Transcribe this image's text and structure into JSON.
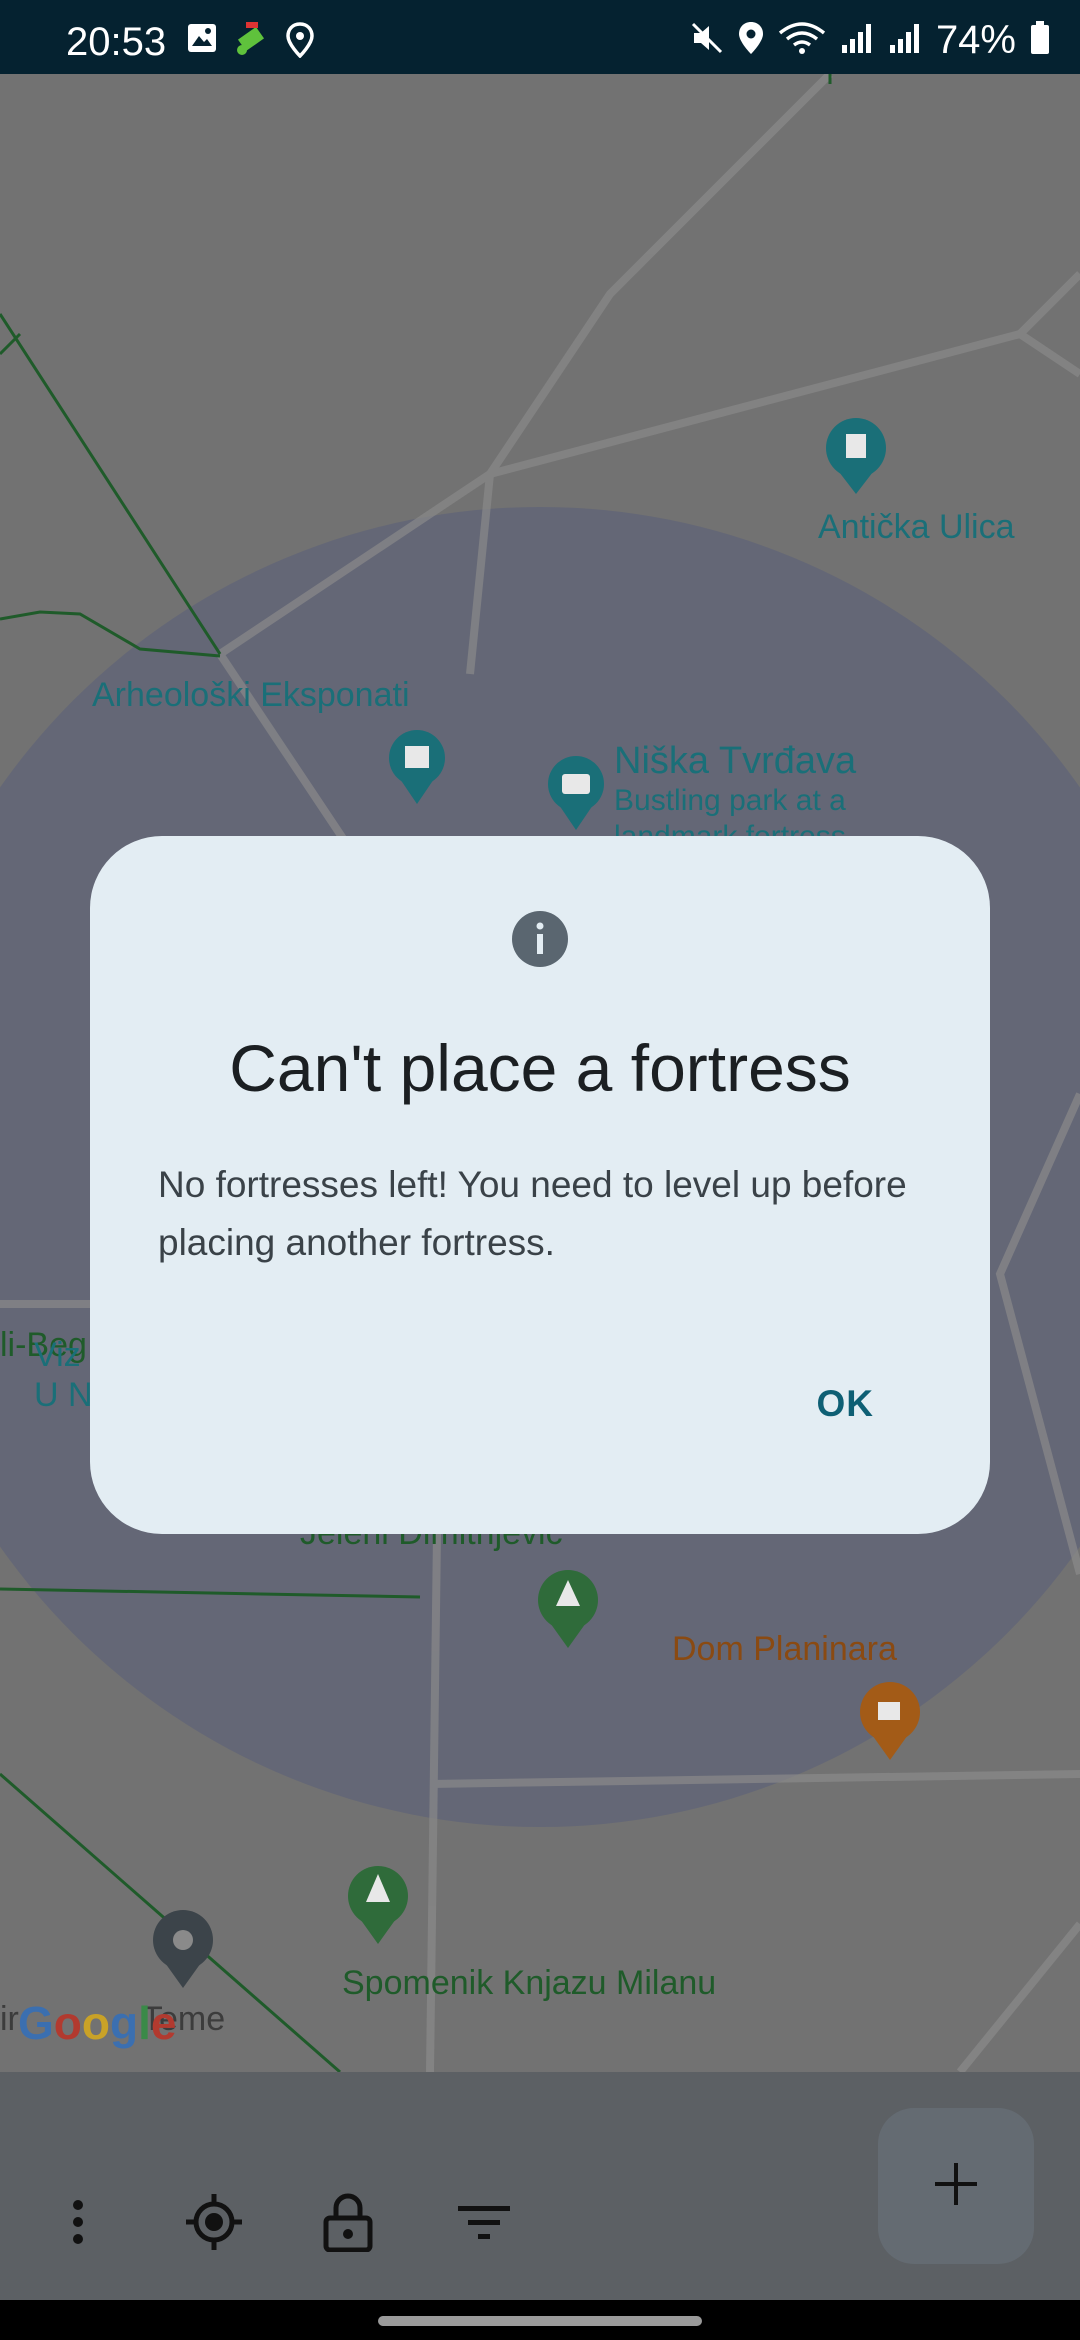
{
  "status_bar": {
    "time": "20:53",
    "battery_percent": "74%",
    "left_icons": [
      "gallery-icon",
      "satellite-app-icon",
      "location-pin-icon"
    ],
    "right_icons": [
      "mute-icon",
      "location-icon",
      "wifi-icon",
      "signal-icon",
      "signal-icon-2",
      "battery-icon"
    ]
  },
  "map": {
    "pois": [
      {
        "label": "Antička Ulica",
        "color": "teal"
      },
      {
        "label": "Arheološki Eksponati",
        "color": "teal"
      },
      {
        "label": "Niška Tvrđava",
        "color": "teal"
      },
      {
        "label": "Bustling park at a",
        "color": "teal"
      },
      {
        "label": "landmark fortress",
        "color": "teal"
      },
      {
        "label": "li-Beg",
        "color": "green"
      },
      {
        "label": "Viz",
        "color": "teal"
      },
      {
        "label": "U N",
        "color": "teal"
      },
      {
        "label": "Jeleni Dimitrijević",
        "color": "green"
      },
      {
        "label": "Dom Planinara",
        "color": "orange"
      },
      {
        "label": "Spomenik Knjazu Milanu",
        "color": "green"
      },
      {
        "label": "ir",
        "color": "gray"
      },
      {
        "label": "Teme",
        "color": "gray"
      }
    ],
    "attribution": "Google",
    "colors": {
      "teal": "#1a6f78",
      "green": "#2f6b3a",
      "orange": "#a35b17",
      "circle": "#5a5f7a"
    }
  },
  "dialog": {
    "icon": "info-icon",
    "title": "Can't place a fortress",
    "message": "No fortresses left! You need to level up before placing another fortress.",
    "ok_label": "OK"
  },
  "bottom_bar": {
    "buttons": [
      "more-vert-icon",
      "my-location-icon",
      "lock-icon",
      "filter-icon"
    ],
    "fab": "add-icon"
  }
}
